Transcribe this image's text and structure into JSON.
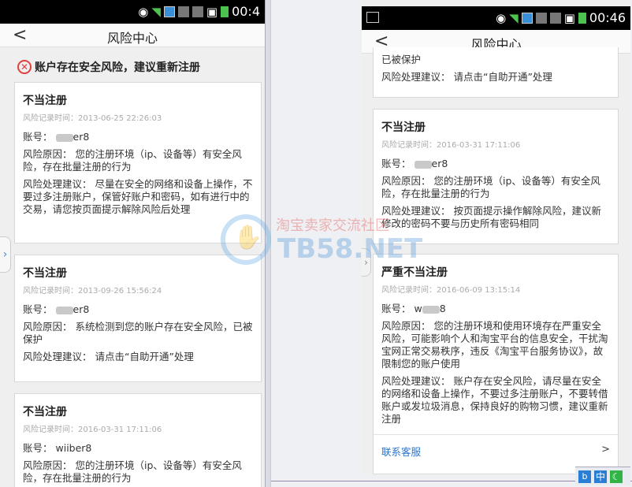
{
  "status": {
    "time": "00:46",
    "left_time": "00:4"
  },
  "header": {
    "title": "风险中心",
    "back": "<"
  },
  "left": {
    "warning": "账户存在安全风险，建议重新注册",
    "cards": [
      {
        "title": "不当注册",
        "time": "风险记录时间：2013-06-25 22:26:03",
        "account_label": "账号：",
        "account_prefix": "",
        "account_suffix": "er8",
        "reason": "风险原因： 您的注册环境（ip、设备等）有安全风险，存在批量注册的行为",
        "advice": "风险处理建议： 尽量在安全的网络和设备上操作，不要过多注册账户，保管好账户和密码，如有进行中的交易，请您按页面提示解除风险后处理"
      },
      {
        "title": "不当注册",
        "time": "风险记录时间：2013-09-26 15:56:24",
        "account_label": "账号：",
        "account_prefix": "",
        "account_suffix": "er8",
        "reason": "风险原因： 系统检测到您的账户存在安全风险，已被保护",
        "advice": "风险处理建议： 请点击“自助开通”处理"
      },
      {
        "title": "不当注册",
        "time": "风险记录时间：2016-03-31 17:11:06",
        "account_label": "账号：",
        "account": "wiiber8",
        "reason": "风险原因： 您的注册环境（ip、设备等）有安全风险，存在批量注册的行为"
      }
    ]
  },
  "right": {
    "top_card": {
      "line1": "已被保护",
      "advice": "风险处理建议： 请点击“自助开通”处理"
    },
    "cards": [
      {
        "title": "不当注册",
        "time": "风险记录时间：2016-03-31 17:11:06",
        "account_label": "账号：",
        "account_suffix": "er8",
        "reason": "风险原因： 您的注册环境（ip、设备等）有安全风险，存在批量注册的行为",
        "advice": "风险处理建议： 按页面提示操作解除风险，建议新修改的密码不要与历史所有密码相同"
      },
      {
        "title": "严重不当注册",
        "time": "风险记录时间：2016-06-09 13:15:14",
        "account_label": "账号：",
        "account_prefix": "w",
        "account_suffix": "8",
        "reason": "风险原因： 您的注册环境和使用环境存在严重安全风险，可能影响个人和淘宝平台的信息安全，干扰淘宝网正常交易秩序，违反《淘宝平台服务协议》，故限制您的账户使用",
        "advice": "风险处理建议： 账户存在安全风险，请尽量在安全的网络和设备上操作，不要过多注册账户，不要转借账户或发垃圾消息，保持良好的购物习惯，建议重新注册",
        "contact": "联系客服",
        "contact_arrow": ">"
      }
    ]
  },
  "watermark": {
    "cn": "淘宝卖家交流社区",
    "en": "TB58.NET"
  },
  "tray": {
    "zh": "中"
  }
}
